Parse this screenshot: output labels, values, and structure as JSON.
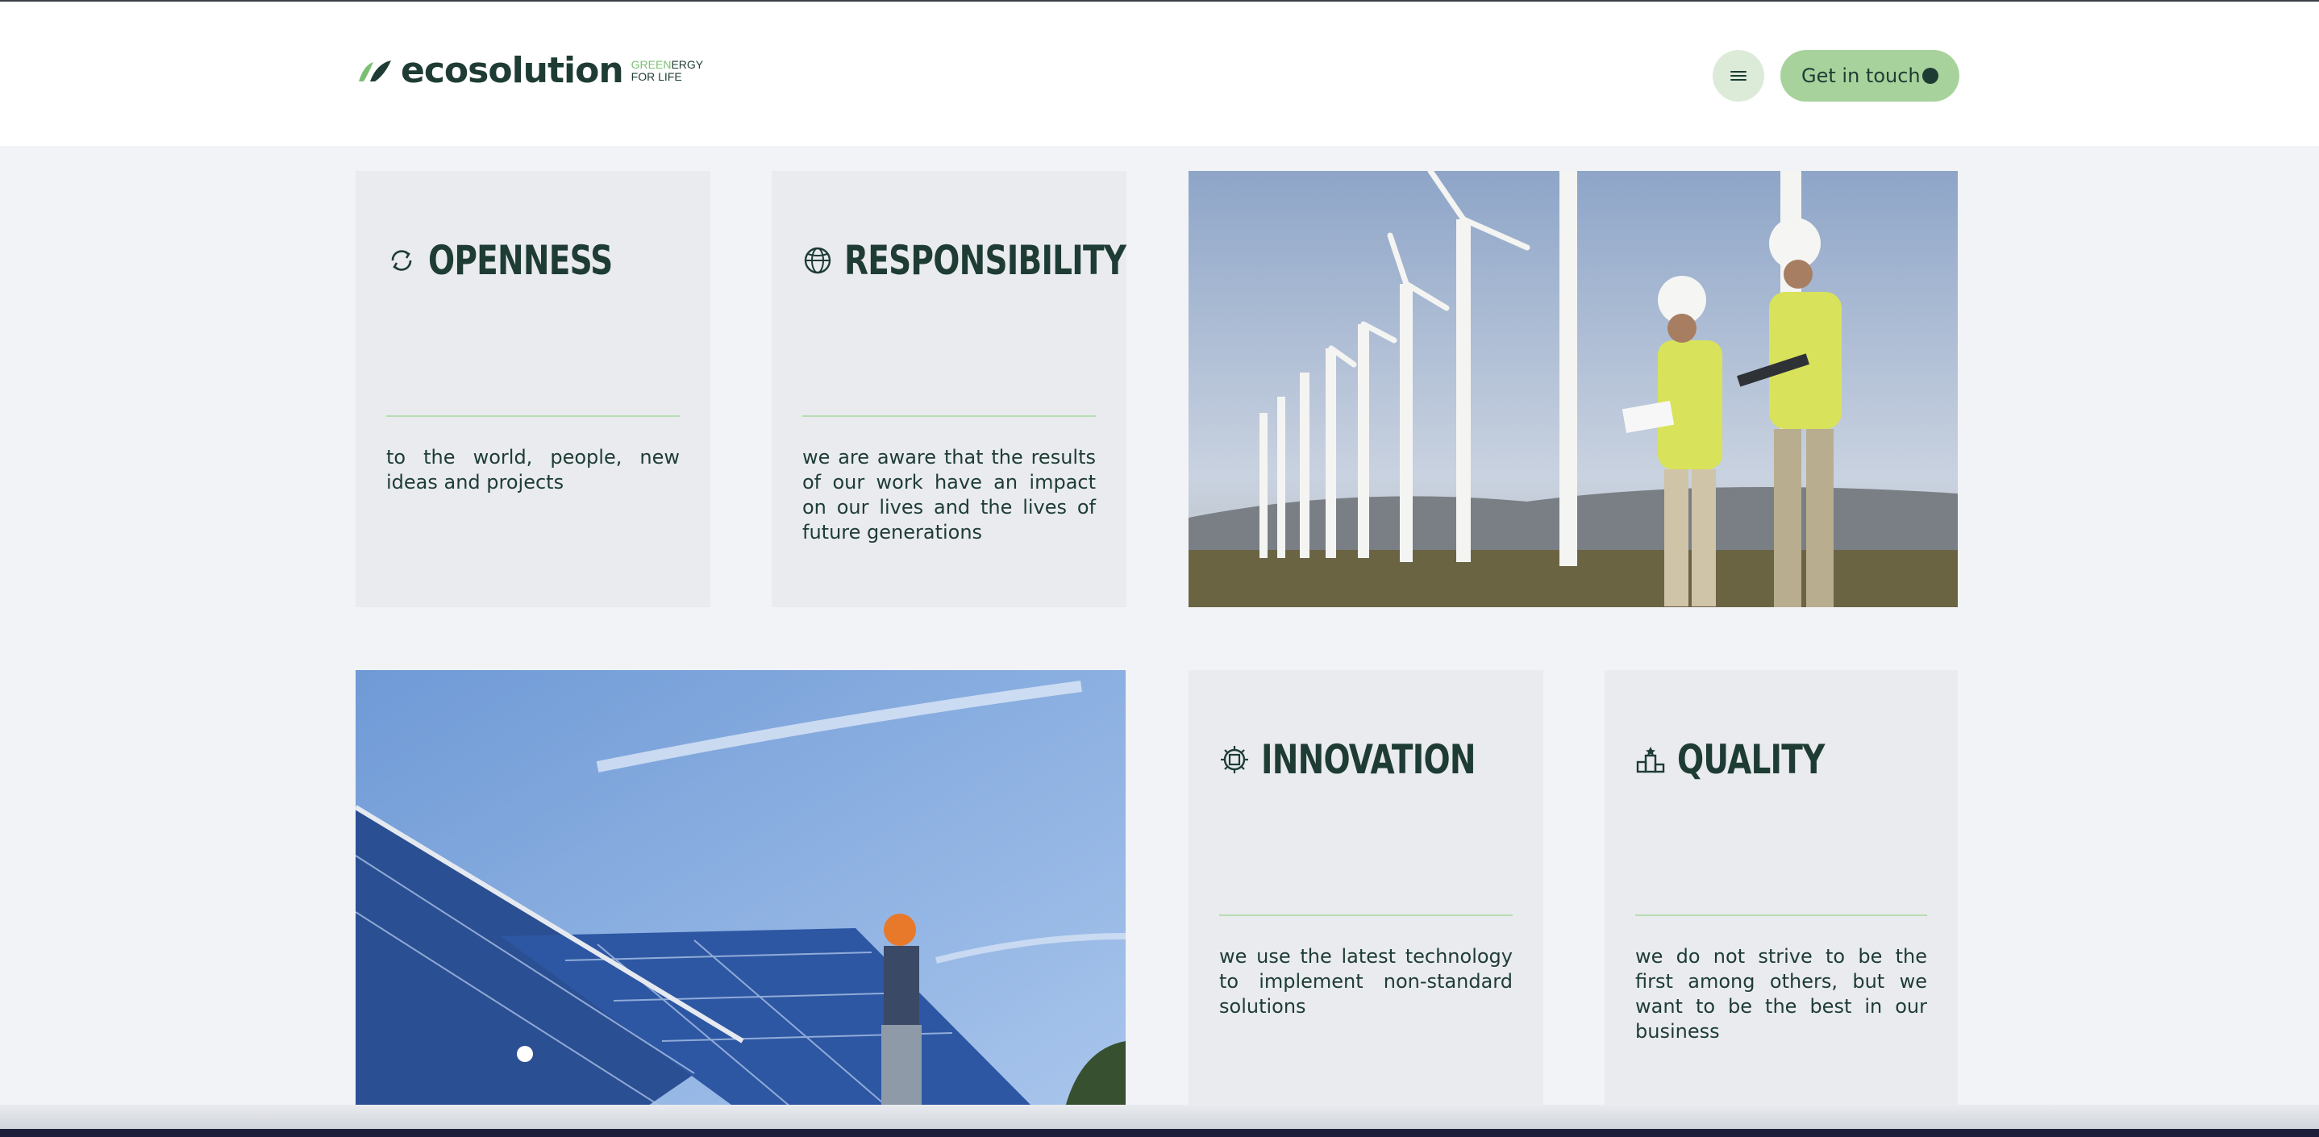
{
  "brand": {
    "name": "ecosolution",
    "tagline_green": "GREEN",
    "tagline_rest": "ERGY",
    "tagline_line2": "FOR LIFE",
    "accent": "#a8d29c",
    "dark": "#1e3c34"
  },
  "header": {
    "menu_icon": "hamburger-icon",
    "cta_label": "Get in touch"
  },
  "values": [
    {
      "icon": "refresh-icon",
      "title": "OPENNESS",
      "text": "to the world, people, new ideas and projects"
    },
    {
      "icon": "globe-icon",
      "title": "RESPONSIBILITY",
      "text": "we are aware that the results of our work have an impact on our lives and the lives of future generations"
    },
    {
      "icon": "cpu-icon",
      "title": "INNOVATION",
      "text": "we use the latest technology to implement non-standard solutions"
    },
    {
      "icon": "podium-icon",
      "title": "QUALITY",
      "text": "we do not strive to be the first among others, but we want to be the best in our business"
    }
  ]
}
